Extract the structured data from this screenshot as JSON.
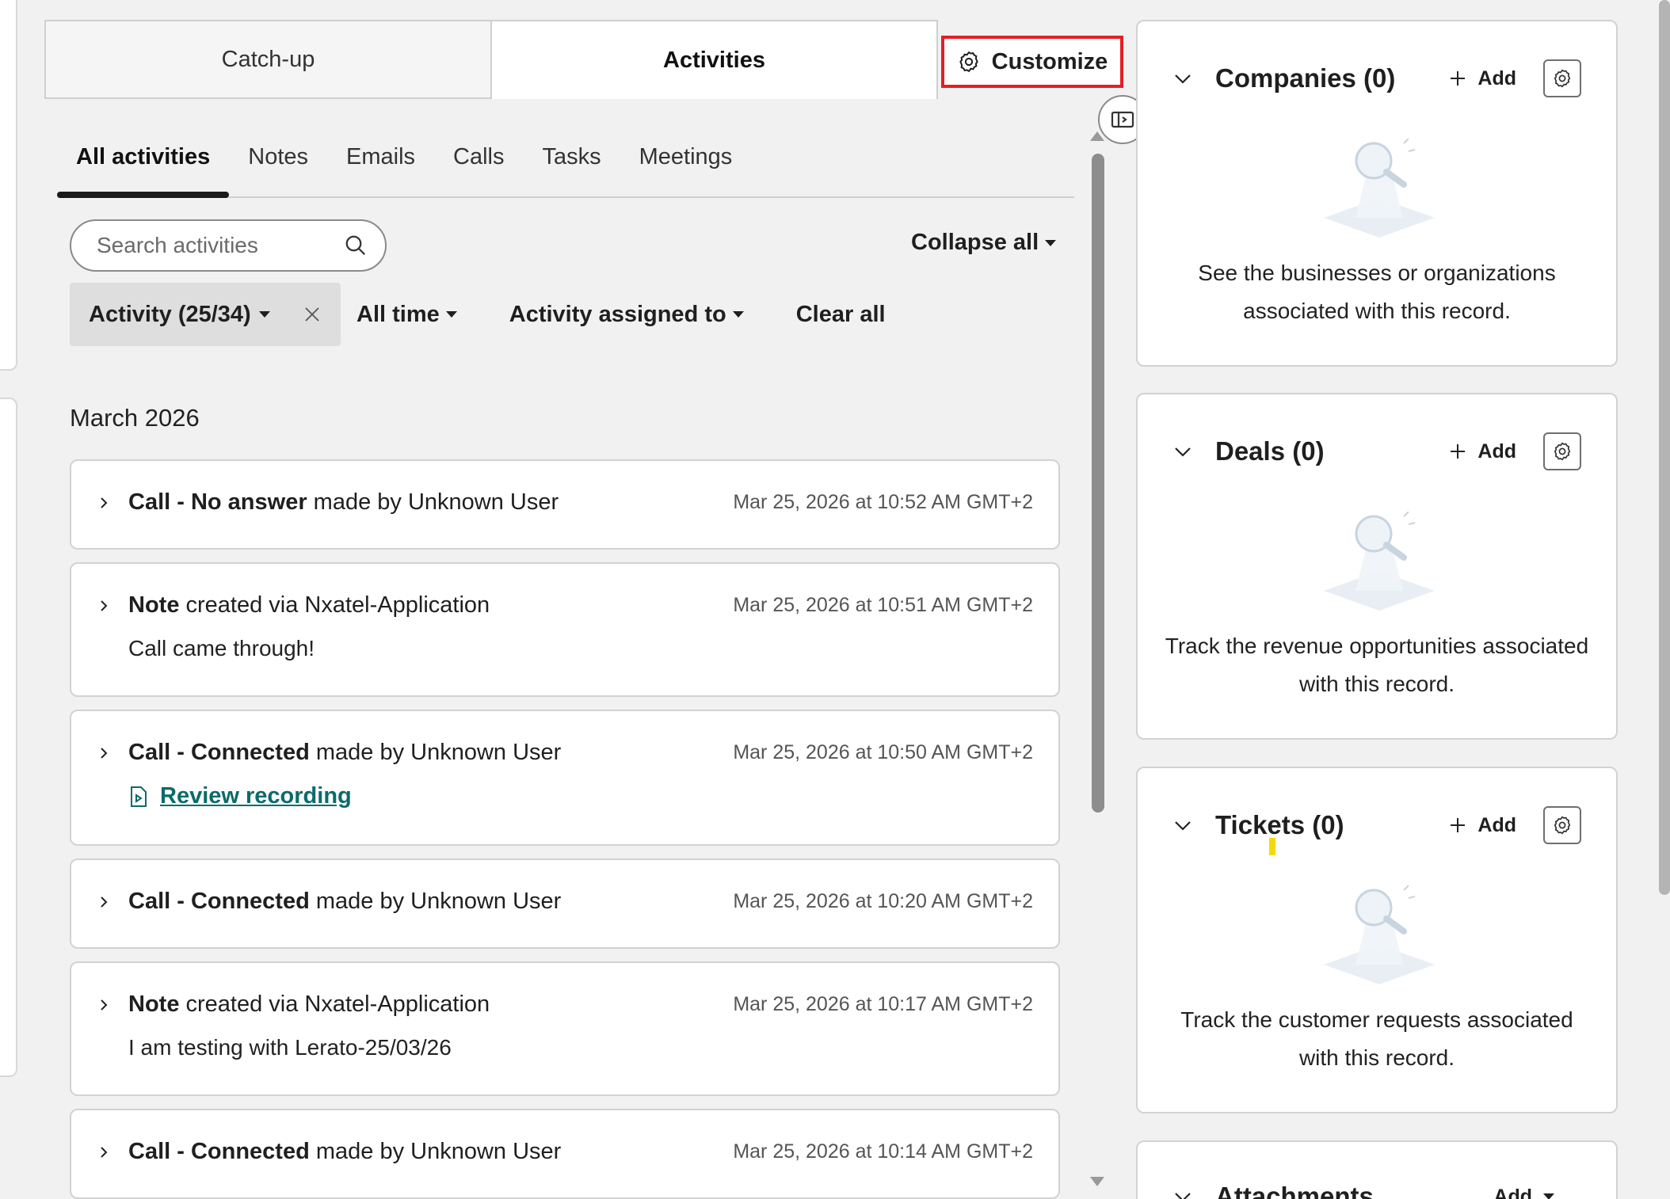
{
  "tabs": {
    "catchup": "Catch-up",
    "activities": "Activities",
    "customize": "Customize"
  },
  "sub_tabs": [
    "All activities",
    "Notes",
    "Emails",
    "Calls",
    "Tasks",
    "Meetings"
  ],
  "search": {
    "placeholder": "Search activities"
  },
  "collapse_all": "Collapse all",
  "filters": {
    "activity": "Activity (25/34)",
    "time": "All time",
    "assigned": "Activity assigned to",
    "clear": "Clear all"
  },
  "month": "March 2026",
  "activities": [
    {
      "type_bold": "Call - No answer",
      "rest": " made by Unknown User",
      "time": "Mar 25, 2026 at 10:52 AM GMT+2"
    },
    {
      "type_bold": "Note",
      "rest": " created via Nxatel-Application",
      "time": "Mar 25, 2026 at 10:51 AM GMT+2",
      "body": "Call came through!"
    },
    {
      "type_bold": "Call - Connected",
      "rest": " made by Unknown User",
      "time": "Mar 25, 2026 at 10:50 AM GMT+2",
      "link": "Review recording"
    },
    {
      "type_bold": "Call - Connected",
      "rest": " made by Unknown User",
      "time": "Mar 25, 2026 at 10:20 AM GMT+2"
    },
    {
      "type_bold": "Note",
      "rest": " created via Nxatel-Application",
      "time": "Mar 25, 2026 at 10:17 AM GMT+2",
      "body": "I am testing with Lerato-25/03/26"
    },
    {
      "type_bold": "Call - Connected",
      "rest": " made by Unknown User",
      "time": "Mar 25, 2026 at 10:14 AM GMT+2"
    }
  ],
  "sidebar": {
    "add_label": "Add",
    "companies": {
      "title": "Companies (0)",
      "desc": "See the businesses or organizations associated with this record."
    },
    "deals": {
      "title": "Deals (0)",
      "desc": "Track the revenue opportunities associated with this record."
    },
    "tickets": {
      "title": "Tickets (0)",
      "desc": "Track the customer requests associated with this record."
    },
    "attachments": {
      "title": "Attachments"
    }
  },
  "colors": {
    "highlight": "#e21f26",
    "link": "#0b6b6b",
    "marker": "#f5d90a"
  }
}
